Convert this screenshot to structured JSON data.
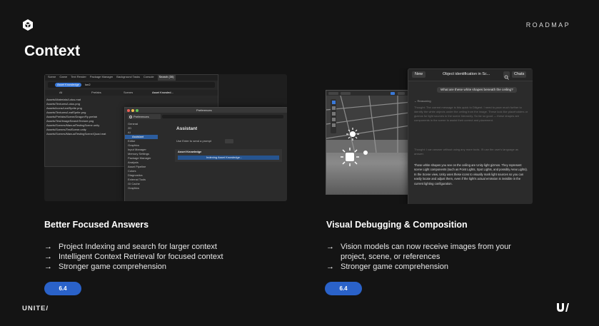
{
  "header": {
    "roadmap_label": "ROADMAP",
    "title": "Context"
  },
  "left": {
    "heading": "Better Focused Answers",
    "bullets": [
      "Project Indexing and search for larger context",
      "Intelligent Context Retrieval for focused context",
      "Stronger game comprehension"
    ],
    "badge": "6.4",
    "editor": {
      "tabs": [
        "Scene",
        "Game",
        "Text Render",
        "Package Manager",
        "Background Tasks",
        "Console",
        "Search (30)"
      ],
      "search_chip": "Asset Knowledge",
      "search_value": "lon2",
      "filter_columns": [
        "All",
        "Prefabs",
        "Scenes",
        "Asset Knowled..."
      ],
      "results": [
        "Assets/Materials/Lotus.mat",
        "Assets/Textures/Lotus.png",
        "Assets/Icons/LeafSprite.png",
        "Assets/Textures/LeafSprite.png",
        "Assets/Prefabs/Scene/DragonFly.prefab",
        "Assets/Test/ImageSearchTexture.png",
        "Assets/Scenes/ManualTestingScene.unity",
        "Assets/Scenes/TestScene.unity",
        "Assets/Scenes/ManualTestingScene/Quad.mat"
      ],
      "prefs_title": "Preferences",
      "prefs_categories": [
        "General",
        "2D",
        "AI",
        "Assistant",
        "Editor",
        "Graphics",
        "Input Manager",
        "Memory Settings",
        "Package Manager",
        "Analysis",
        "Asset Pipeline",
        "Colors",
        "Diagnostics",
        "External Tools",
        "GI Cache",
        "Graphics"
      ],
      "assistant_heading": "Assistant",
      "assistant_send_label": "Use Enter to send a prompt",
      "asset_knowledge_label": "Asset Knowledge",
      "indexing_text": "Indexing Asset Knowledge..."
    }
  },
  "right": {
    "heading": "Visual Debugging & Composition",
    "bullets": [
      "Vision models can now receive images from your project, scene, or references",
      "Stronger game comprehension"
    ],
    "badge": "6.4",
    "assistant": {
      "new_button": "New",
      "chat_title": "Object identification in Sc...",
      "chats_button": "Chats",
      "user_prompt": "What are these white shapes beneath the ceiling?",
      "reasoning_label": "Reasoning",
      "thought_1": "Thought: The current message is this quick to Diligent. I need to pace much further to identify the white objects under the ceiling from the image. These look like placeholders or gizmos for light sources in the scene hierarchy. So far so good — these shapes are components in the scene to assist their correct and placement.",
      "thought_2": "Thought: I can answer without using any more tools. I'll use the user's language as answer.",
      "answer": "Those white shapes you see on the ceiling are Unity light gizmos. They represent scene Light components (such as Point Lights, Spot Lights, and possibly Area Lights). In the Scene view, Unity uses these icons to visually mark light sources so you can easily locate and adjust them, even if the light's actual emission is invisible in the current lighting configuration."
    }
  },
  "footer": {
    "event_label": "UNITE/"
  },
  "colors": {
    "background": "#141414",
    "badge": "#2a62c9",
    "accent_blue": "#3a79d8"
  }
}
